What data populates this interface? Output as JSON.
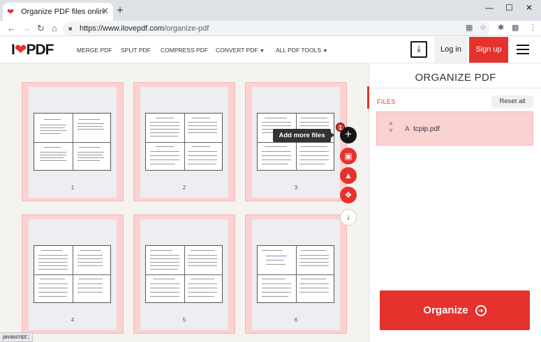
{
  "browser": {
    "tab_title": "Organize PDF files online. Free",
    "url_host": "https://www.ilovepdf.com",
    "url_path": "/organize-pdf",
    "status_text": "javascript:;"
  },
  "header": {
    "logo_left": "I",
    "logo_right": "PDF",
    "nav": [
      "MERGE PDF",
      "SPLIT PDF",
      "COMPRESS PDF",
      "CONVERT PDF",
      "ALL PDF TOOLS"
    ],
    "login_label": "Log in",
    "signup_label": "Sign up"
  },
  "workspace": {
    "pages": [
      "1",
      "2",
      "3",
      "4",
      "5",
      "6"
    ],
    "file_count_badge": "1",
    "tooltip": "Add more files"
  },
  "panel": {
    "title": "ORGANIZE PDF",
    "files_label": "FILES",
    "reset_label": "Reset all",
    "file_sort_letter": "A",
    "file_name": "tcpip.pdf",
    "organize_label": "Organize"
  },
  "colors": {
    "brand_red": "#e5322d",
    "card_pink": "#fbd2d2",
    "workspace_bg": "#f5f3ef"
  }
}
